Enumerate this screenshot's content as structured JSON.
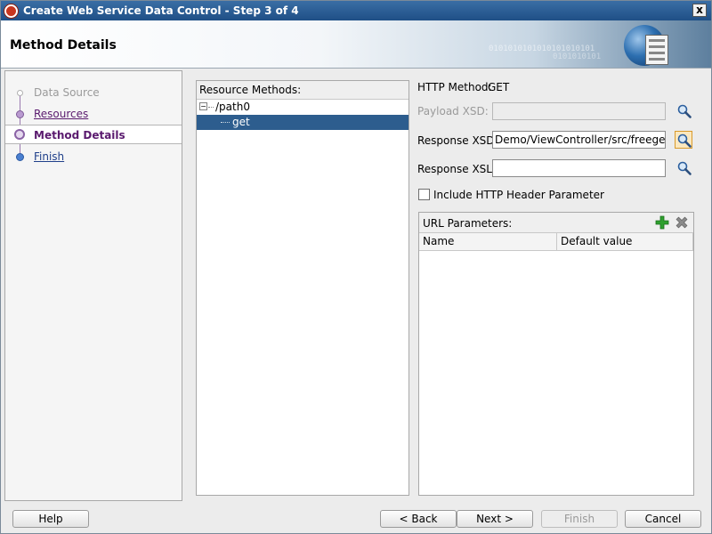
{
  "window": {
    "title": "Create Web Service Data Control - Step 3 of 4",
    "close_label": "x"
  },
  "header": {
    "title": "Method Details",
    "binary_a": "0101010101010101010101",
    "binary_b": "0101010101"
  },
  "steps": [
    {
      "label": "Data Source",
      "state": "disabled"
    },
    {
      "label": "Resources",
      "state": "link"
    },
    {
      "label": "Method Details",
      "state": "current"
    },
    {
      "label": "Finish",
      "state": "finish"
    }
  ],
  "resources": {
    "title": "Resource Methods:",
    "tree": [
      {
        "label": "/path0",
        "expander": "−",
        "selected": false
      },
      {
        "label": "get",
        "selected": true
      }
    ]
  },
  "form": {
    "http_method_label": "HTTP Method:",
    "http_method_value": "GET",
    "payload_xsd_label": "Payload XSD:",
    "payload_xsd_value": "",
    "response_xsd_label": "Response XSD:",
    "response_xsd_value": "Demo/ViewController/src/freegeoip.xsd",
    "response_xsl_label": "Response XSL:",
    "response_xsl_value": "",
    "include_header_label": "Include HTTP Header Parameter",
    "include_header_checked": false
  },
  "url_params": {
    "title": "URL Parameters:",
    "columns": [
      "Name",
      "Default value"
    ],
    "rows": []
  },
  "buttons": {
    "help": "Help",
    "back": "< Back",
    "next": "Next >",
    "finish": "Finish",
    "cancel": "Cancel"
  },
  "colors": {
    "selection": "#2d5d8e",
    "step_current": "#5a1a6e",
    "add": "#2ea02e",
    "delete": "#707070"
  }
}
